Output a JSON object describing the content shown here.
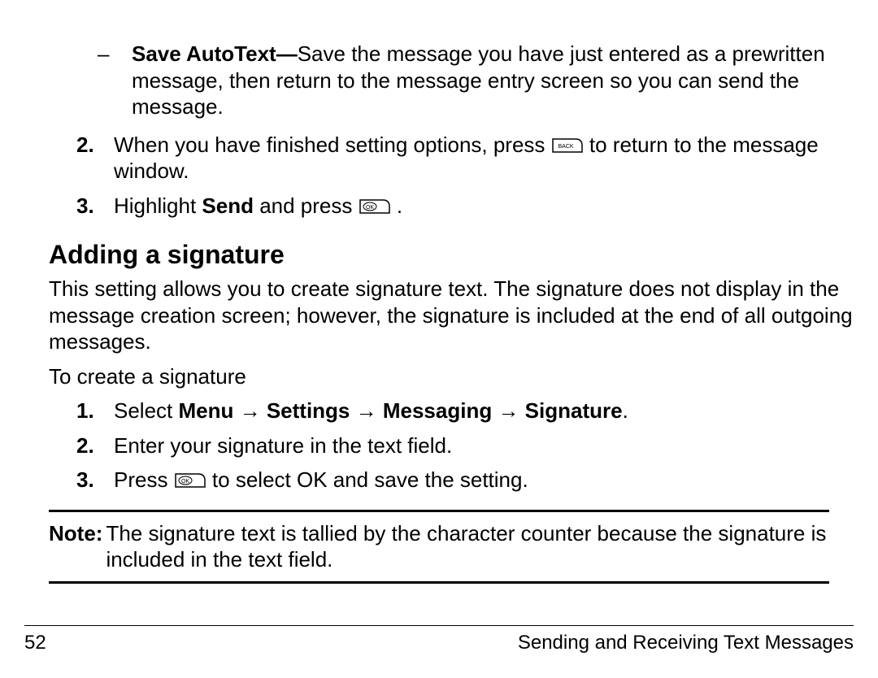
{
  "bullet1": {
    "lead": "Save AutoText—",
    "rest": "Save the message you have just entered as a prewritten message, then return to the message entry screen so you can send the message."
  },
  "step2": {
    "num": "2.",
    "pre": "When you have finished setting options, press ",
    "post": " to return to the message window."
  },
  "step3": {
    "num": "3.",
    "pre": "Highlight ",
    "bold": "Send",
    "mid": " and press ",
    "post": " ."
  },
  "heading": "Adding a signature",
  "intro": "This setting allows you to create signature text. The signature does not display in the message creation screen; however, the signature is included at the end of all outgoing messages.",
  "lead2": "To create a signature",
  "sig1": {
    "num": "1.",
    "pre": "Select ",
    "path": "Menu → Settings → Messaging → Signature",
    "post": "."
  },
  "sig2": {
    "num": "2.",
    "text": "Enter your signature in the text field."
  },
  "sig3": {
    "num": "3.",
    "pre": "Press ",
    "post": " to select OK and save the setting."
  },
  "note": {
    "label": "Note:",
    "text": "The signature text is tallied by the character counter because the signature is included in the text field."
  },
  "footer": {
    "page": "52",
    "title": "Sending and Receiving Text Messages"
  },
  "icons": {
    "back": "back-key-icon",
    "ok": "ok-key-icon"
  }
}
